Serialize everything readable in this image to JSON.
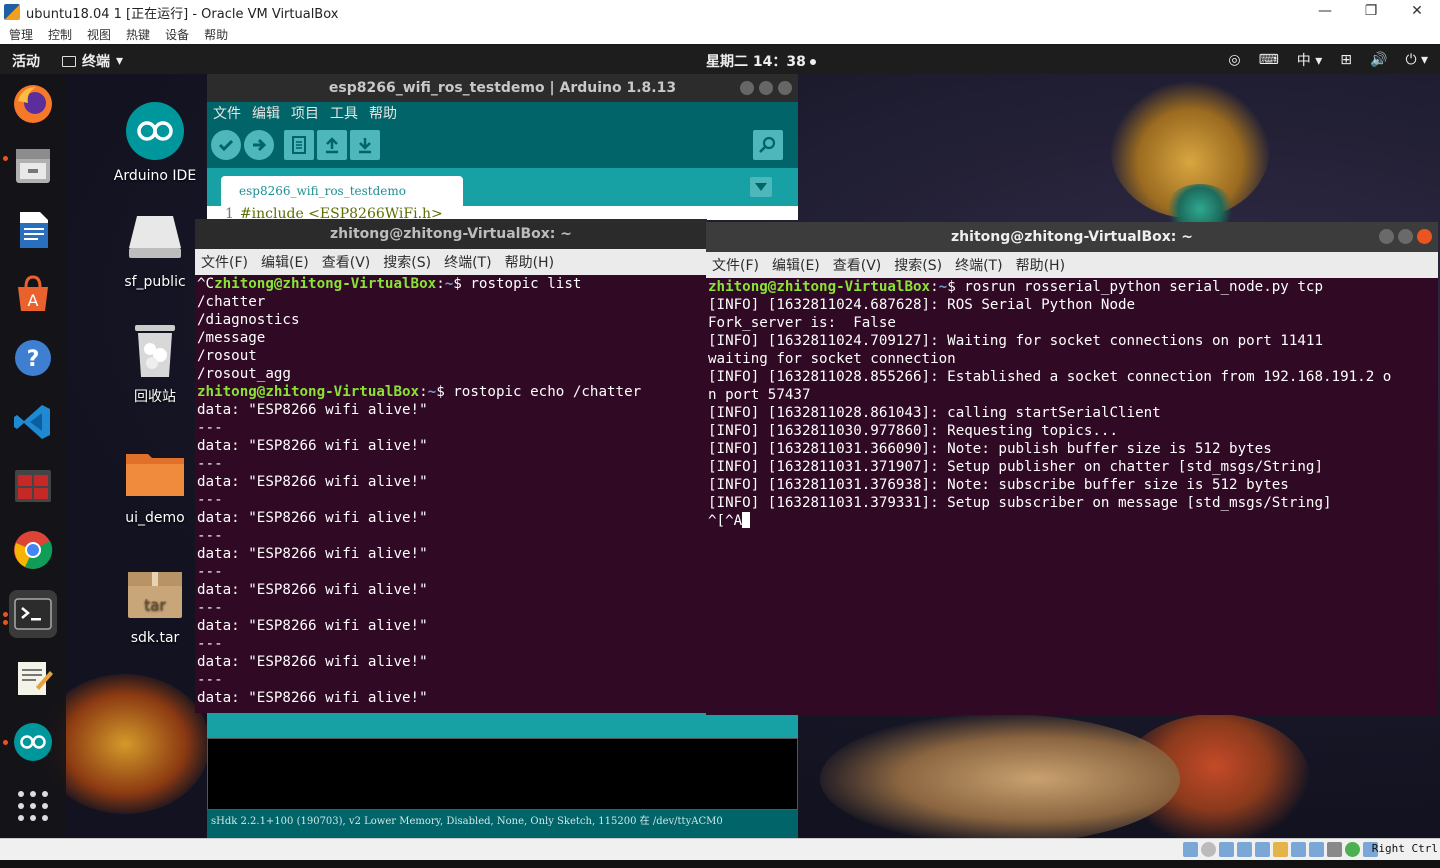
{
  "host": {
    "title": "ubuntu18.04 1 [正在运行] - Oracle VM VirtualBox",
    "window_controls": [
      "—",
      "❐",
      "✕"
    ],
    "menu": [
      "管理",
      "控制",
      "视图",
      "热键",
      "设备",
      "帮助"
    ],
    "host_key": "Right Ctrl"
  },
  "topbar": {
    "activities": "活动",
    "app_name": "终端",
    "clock": "星期二 14：38",
    "ime": "中"
  },
  "desktop_icons": [
    {
      "label": "Arduino IDE"
    },
    {
      "label": "sf_public"
    },
    {
      "label": "回收站"
    },
    {
      "label": "ui_demo"
    },
    {
      "label": "sdk.tar"
    }
  ],
  "arduino": {
    "title": "esp8266_wifi_ros_testdemo | Arduino 1.8.13",
    "menu": [
      "文件",
      "编辑",
      "项目",
      "工具",
      "帮助"
    ],
    "tab": "esp8266_wifi_ros_testdemo",
    "code_line_no": "1",
    "code_line": "#include <ESP8266WiFi.h>",
    "status": "sHdk 2.2.1+100 (190703), v2 Lower Memory, Disabled, None, Only Sketch, 115200 在 /dev/ttyACM0"
  },
  "term1": {
    "title": "zhitong@zhitong-VirtualBox: ~",
    "menu": [
      "文件(F)",
      "编辑(E)",
      "查看(V)",
      "搜索(S)",
      "终端(T)",
      "帮助(H)"
    ],
    "user": "zhitong@zhitong-VirtualBox",
    "path": "~",
    "line1_prefix": "^C",
    "cmd1": "$ rostopic list",
    "topics": [
      "/chatter",
      "/diagnostics",
      "/message",
      "/rosout",
      "/rosout_agg"
    ],
    "cmd2": "$ rostopic echo /chatter",
    "data_line": "data: \"ESP8266 wifi alive!\"",
    "separator": "---"
  },
  "term2": {
    "title": "zhitong@zhitong-VirtualBox: ~",
    "menu": [
      "文件(F)",
      "编辑(E)",
      "查看(V)",
      "搜索(S)",
      "终端(T)",
      "帮助(H)"
    ],
    "user": "zhitong@zhitong-VirtualBox",
    "path": "~",
    "cmd": "$ rosrun rosserial_python serial_node.py tcp",
    "lines": [
      "[INFO] [1632811024.687628]: ROS Serial Python Node",
      "Fork_server is:  False",
      "[INFO] [1632811024.709127]: Waiting for socket connections on port 11411",
      "waiting for socket connection",
      "[INFO] [1632811028.855266]: Established a socket connection from 192.168.191.2 o",
      "n port 57437",
      "[INFO] [1632811028.861043]: calling startSerialClient",
      "[INFO] [1632811030.977860]: Requesting topics...",
      "[INFO] [1632811031.366090]: Note: publish buffer size is 512 bytes",
      "[INFO] [1632811031.371907]: Setup publisher on chatter [std_msgs/String]",
      "[INFO] [1632811031.376938]: Note: subscribe buffer size is 512 bytes",
      "[INFO] [1632811031.379331]: Setup subscriber on message [std_msgs/String]"
    ],
    "last_line": "^[^A"
  },
  "colors": {
    "terminal_bg": "#300a24",
    "prompt_user": "#8ae234",
    "prompt_path": "#729fcf",
    "arduino_teal": "#006468",
    "arduino_tab_bar": "#17a1a5",
    "ubuntu_orange": "#e95420"
  }
}
